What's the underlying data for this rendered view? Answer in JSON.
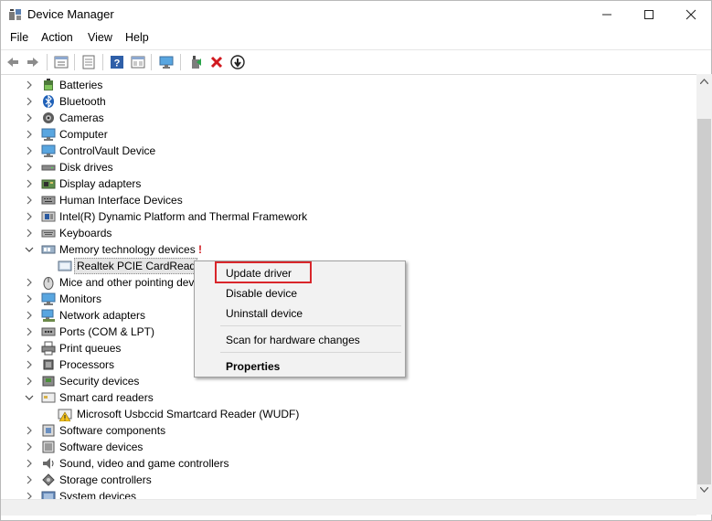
{
  "window": {
    "title": "Device Manager",
    "controls": [
      "minimize",
      "maximize",
      "close"
    ]
  },
  "menu": [
    "File",
    "Action",
    "View",
    "Help"
  ],
  "toolbar": [
    "back-icon",
    "forward-icon",
    "properties-icon",
    "computer-list-icon",
    "help-icon",
    "resources-icon",
    "monitor-icon",
    "update-driver-icon",
    "uninstall-icon",
    "scan-icon"
  ],
  "tree": [
    {
      "label": "Batteries",
      "icon": "battery-icon",
      "state": "collapsed"
    },
    {
      "label": "Bluetooth",
      "icon": "bluetooth-icon",
      "state": "collapsed"
    },
    {
      "label": "Cameras",
      "icon": "camera-icon",
      "state": "collapsed"
    },
    {
      "label": "Computer",
      "icon": "computer-icon",
      "state": "collapsed"
    },
    {
      "label": "ControlVault Device",
      "icon": "controlvault-icon",
      "state": "collapsed"
    },
    {
      "label": "Disk drives",
      "icon": "disk-drive-icon",
      "state": "collapsed"
    },
    {
      "label": "Display adapters",
      "icon": "display-adapter-icon",
      "state": "collapsed"
    },
    {
      "label": "Human Interface Devices",
      "icon": "hid-icon",
      "state": "collapsed"
    },
    {
      "label": "Intel(R) Dynamic Platform and Thermal Framework",
      "icon": "intel-icon",
      "state": "collapsed"
    },
    {
      "label": "Keyboards",
      "icon": "keyboard-icon",
      "state": "collapsed"
    },
    {
      "label": "Memory technology devices",
      "icon": "memory-icon",
      "state": "expanded"
    },
    {
      "label": "Realtek PCIE CardReader",
      "icon": "card-reader-icon",
      "state": "child",
      "selected": true
    },
    {
      "label": "Mice and other pointing devices",
      "icon": "mouse-icon",
      "state": "collapsed"
    },
    {
      "label": "Monitors",
      "icon": "monitor-icon",
      "state": "collapsed"
    },
    {
      "label": "Network adapters",
      "icon": "network-icon",
      "state": "collapsed"
    },
    {
      "label": "Ports (COM & LPT)",
      "icon": "port-icon",
      "state": "collapsed"
    },
    {
      "label": "Print queues",
      "icon": "printer-icon",
      "state": "collapsed"
    },
    {
      "label": "Processors",
      "icon": "processor-icon",
      "state": "collapsed"
    },
    {
      "label": "Security devices",
      "icon": "security-icon",
      "state": "collapsed"
    },
    {
      "label": "Smart card readers",
      "icon": "smart-card-icon",
      "state": "expanded"
    },
    {
      "label": "Microsoft Usbccid Smartcard Reader (WUDF)",
      "icon": "warning-icon",
      "state": "child"
    },
    {
      "label": "Software components",
      "icon": "software-component-icon",
      "state": "collapsed"
    },
    {
      "label": "Software devices",
      "icon": "software-device-icon",
      "state": "collapsed"
    },
    {
      "label": "Sound, video and game controllers",
      "icon": "sound-icon",
      "state": "collapsed"
    },
    {
      "label": "Storage controllers",
      "icon": "storage-icon",
      "state": "collapsed"
    },
    {
      "label": "System devices",
      "icon": "system-icon",
      "state": "collapsed"
    }
  ],
  "warning_marker": "!",
  "context_menu": {
    "items": [
      "Update driver",
      "Disable device",
      "Uninstall device",
      "Scan for hardware changes",
      "Properties"
    ],
    "highlighted": "Update driver",
    "highlight_color": "#d9262b"
  }
}
